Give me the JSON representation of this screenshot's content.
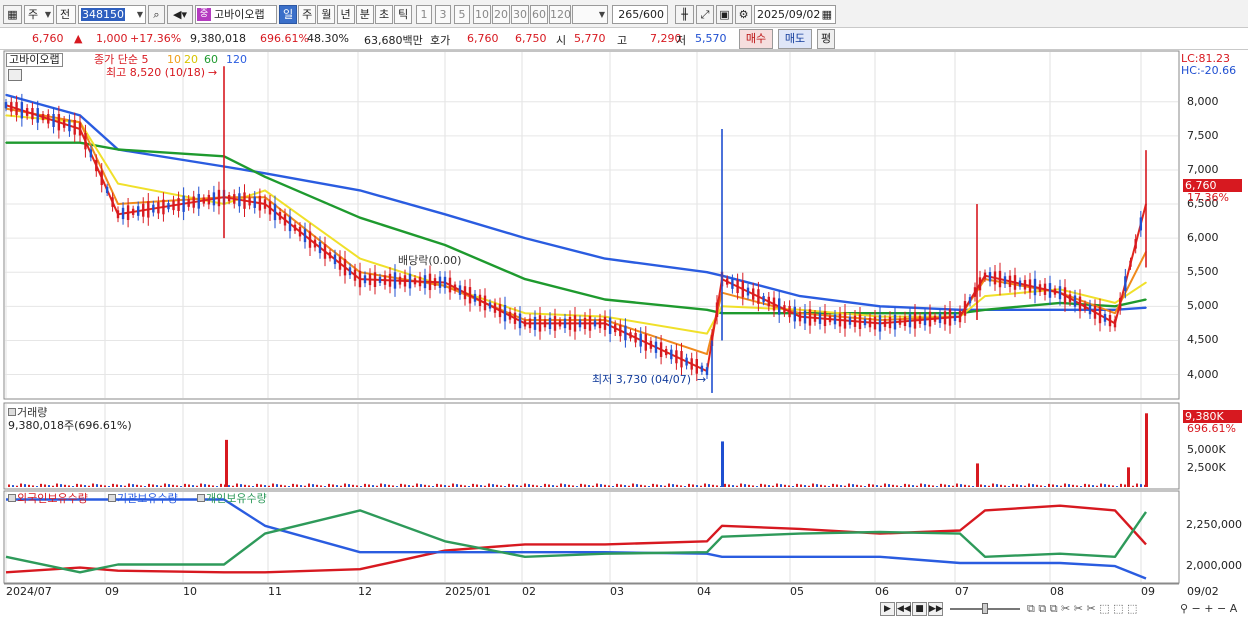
{
  "toolbar": {
    "period_label": "주",
    "prev_label": "전",
    "stock_code": "348150",
    "badge": "중",
    "stock_name": "고바이오랩",
    "intervals": [
      "일",
      "주",
      "월",
      "년",
      "분",
      "초",
      "틱"
    ],
    "selected_interval": "일",
    "minute_steps": [
      "1",
      "3",
      "5",
      "10",
      "20",
      "30",
      "60",
      "120"
    ],
    "count_value": "265",
    "count_total": "/600",
    "date_value": "2025/09/02"
  },
  "quote": {
    "price": "6,760",
    "change": "1,000",
    "change_pct": "+17.36%",
    "volume": "9,380,018",
    "volume_pct": "696.61%",
    "turnover_pct": "48.30%",
    "amount": "63,680백만",
    "bid_label": "호가",
    "ask_price": "6,760",
    "bid_price": "6,750",
    "open_label": "시",
    "open": "5,770",
    "high_label": "고",
    "high": "7,290",
    "low_label": "저",
    "low": "5,570",
    "buy_label": "매수",
    "sell_label": "매도",
    "eval_label": "평"
  },
  "price_panel": {
    "legend_name": "고바이오랩",
    "legend_series": "종가 단순 5",
    "ma_labels": [
      "10",
      "20",
      "60",
      "120"
    ],
    "lc": "LC:81.23",
    "hc": "HC:-20.66",
    "max_note": "최고 8,520 (10/18)",
    "min_note": "최저 3,730 (04/07)",
    "event_note": "배당락(0.00)",
    "current_price_tag": "6,760",
    "current_pct_tag": "17.36%",
    "y_ticks": [
      "8,000",
      "7,500",
      "7,000",
      "6,500",
      "6,000",
      "5,500",
      "5,000",
      "4,500",
      "4,000"
    ]
  },
  "volume_panel": {
    "title": "거래량",
    "value_text": "9,380,018주(696.61%)",
    "tag_value": "9,380K",
    "tag_pct": "696.61%",
    "y_ticks": [
      "5,000K",
      "2,500K"
    ]
  },
  "holdings_panel": {
    "series_names": [
      "외국인보유수량",
      "기관보유수량",
      "개인보유수량"
    ],
    "y_ticks": [
      "2,250,000",
      "2,000,000"
    ]
  },
  "x_axis": {
    "labels": [
      "2024/07",
      "09",
      "10",
      "11",
      "12",
      "2025/01",
      "02",
      "03",
      "04",
      "05",
      "06",
      "07",
      "08",
      "09"
    ],
    "end_label": "09/02"
  },
  "colors": {
    "up": "#d71920",
    "down": "#1f4fd1",
    "ma5": "#e0241b",
    "ma10": "#f08a1c",
    "ma20": "#f0e02a",
    "ma60": "#1e9a2e",
    "ma120": "#2a5ce0",
    "foreign": "#d71920",
    "institution": "#2a5ce0",
    "individual": "#2e9a5a"
  },
  "chart_data": {
    "type": "line",
    "series": [
      {
        "name": "종가 단순 5",
        "role": "ma5",
        "x": [
          "2024/07",
          "2024/08",
          "2024/09",
          "2024/10/18",
          "2024/11",
          "2024/12",
          "2025/01",
          "2025/02",
          "2025/03",
          "2025/04/07",
          "2025/04/15",
          "2025/05",
          "2025/06",
          "2025/07",
          "2025/07/20",
          "2025/08",
          "2025/08/25",
          "2025/09/02"
        ],
        "values": [
          7950,
          7600,
          6350,
          6600,
          6500,
          5400,
          5350,
          4750,
          4750,
          4050,
          5400,
          4850,
          4750,
          4850,
          5450,
          5200,
          4750,
          6500
        ]
      },
      {
        "name": "10",
        "role": "ma10",
        "x": [
          "2024/07",
          "2024/08",
          "2024/09",
          "2024/10/18",
          "2024/11",
          "2024/12",
          "2025/01",
          "2025/02",
          "2025/03",
          "2025/04/07",
          "2025/04/15",
          "2025/05",
          "2025/06",
          "2025/07",
          "2025/07/20",
          "2025/08",
          "2025/08/25",
          "2025/09/02"
        ],
        "values": [
          7900,
          7700,
          6500,
          6600,
          6600,
          5500,
          5300,
          4800,
          4800,
          4300,
          5200,
          4900,
          4800,
          4850,
          5400,
          5200,
          4900,
          5800
        ]
      },
      {
        "name": "20",
        "role": "ma20",
        "x": [
          "2024/07",
          "2024/08",
          "2024/09",
          "2024/10/18",
          "2024/11",
          "2024/12",
          "2025/01",
          "2025/02",
          "2025/03",
          "2025/04/07",
          "2025/04/15",
          "2025/05",
          "2025/06",
          "2025/07",
          "2025/07/20",
          "2025/08",
          "2025/08/25",
          "2025/09/02"
        ],
        "values": [
          7800,
          7700,
          6800,
          6500,
          6700,
          5700,
          5300,
          4900,
          4850,
          4600,
          5000,
          4950,
          4850,
          4850,
          5150,
          5250,
          5050,
          5350
        ]
      },
      {
        "name": "60",
        "role": "ma60",
        "x": [
          "2024/07",
          "2024/08",
          "2024/09",
          "2024/10/18",
          "2024/11",
          "2024/12",
          "2025/01",
          "2025/02",
          "2025/03",
          "2025/04/07",
          "2025/04/15",
          "2025/05",
          "2025/06",
          "2025/07",
          "2025/07/20",
          "2025/08",
          "2025/08/25",
          "2025/09/02"
        ],
        "values": [
          7400,
          7400,
          7300,
          7200,
          6900,
          6300,
          5900,
          5400,
          5100,
          4950,
          4900,
          4900,
          4900,
          4900,
          4950,
          5050,
          5000,
          5100
        ]
      },
      {
        "name": "120",
        "role": "ma120",
        "x": [
          "2024/07",
          "2024/08",
          "2024/09",
          "2024/10/18",
          "2024/11",
          "2024/12",
          "2025/01",
          "2025/02",
          "2025/03",
          "2025/04/07",
          "2025/04/15",
          "2025/05",
          "2025/06",
          "2025/07",
          "2025/07/20",
          "2025/08",
          "2025/08/25",
          "2025/09/02"
        ],
        "values": [
          8100,
          7800,
          7300,
          7050,
          6950,
          6700,
          6350,
          6000,
          5700,
          5500,
          5450,
          5150,
          5000,
          4950,
          4950,
          4950,
          4950,
          4980
        ]
      }
    ],
    "volume_spikes": [
      {
        "x": "2024/10/18",
        "value": 6000
      },
      {
        "x": "2025/04/15",
        "value": 5800
      },
      {
        "x": "2025/07/20",
        "value": 3000
      },
      {
        "x": "2025/08/25",
        "value": 2500
      },
      {
        "x": "2025/09/02",
        "value": 9380
      }
    ],
    "holdings": [
      {
        "name": "외국인보유수량",
        "values": [
          2000000,
          2030000,
          2010000,
          2000000,
          2000000,
          2020000,
          2140000,
          2180000,
          2180000,
          2200000,
          2300000,
          2280000,
          2250000,
          2270000,
          2400000,
          2430000,
          2400000,
          2180000
        ]
      },
      {
        "name": "기관보유수량",
        "values": [
          2470000,
          2470000,
          2470000,
          2470000,
          2300000,
          2130000,
          2130000,
          2130000,
          2130000,
          2120000,
          2100000,
          2100000,
          2100000,
          2060000,
          2060000,
          2060000,
          2040000,
          1960000
        ]
      },
      {
        "name": "개인보유수량",
        "values": [
          2100000,
          2000000,
          2050000,
          2050000,
          2250000,
          2400000,
          2200000,
          2100000,
          2120000,
          2130000,
          2230000,
          2250000,
          2260000,
          2250000,
          2100000,
          2120000,
          2100000,
          2390000
        ]
      }
    ],
    "ylim": [
      3700,
      8700
    ]
  }
}
